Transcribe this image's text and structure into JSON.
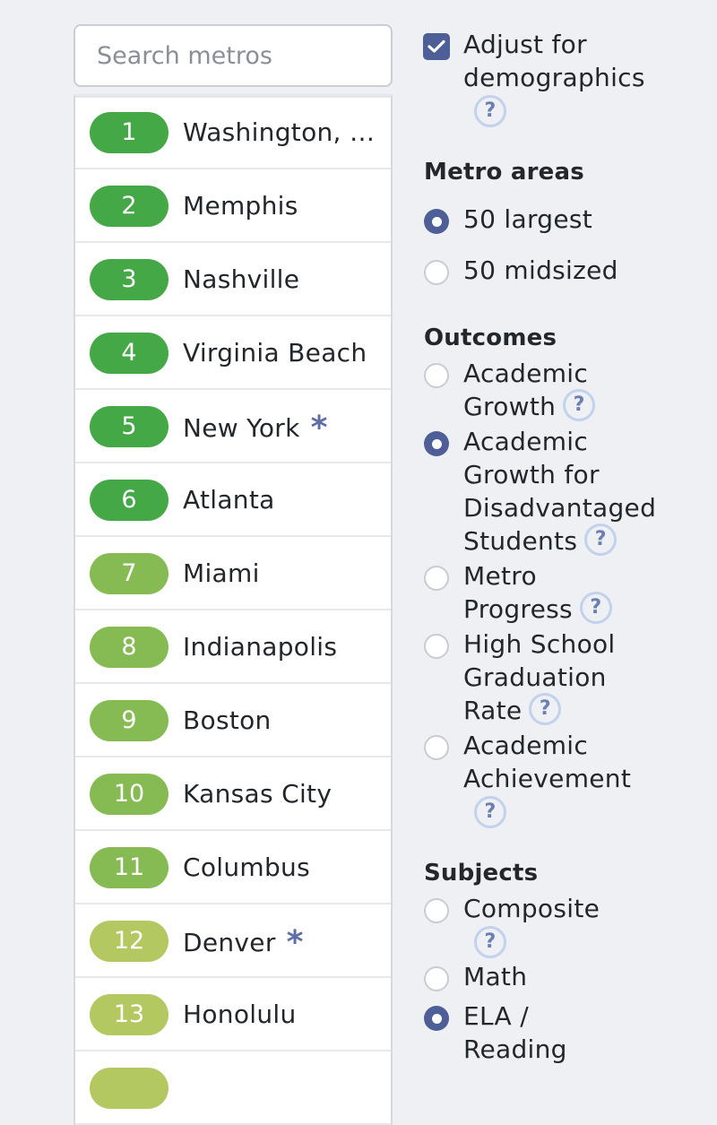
{
  "search": {
    "placeholder": "Search metros"
  },
  "rankings": [
    {
      "rank": "1",
      "name": "Washington, D...",
      "starred": false,
      "color": "#45a847"
    },
    {
      "rank": "2",
      "name": "Memphis",
      "starred": false,
      "color": "#45a847"
    },
    {
      "rank": "3",
      "name": "Nashville",
      "starred": false,
      "color": "#45a847"
    },
    {
      "rank": "4",
      "name": "Virginia Beach",
      "starred": false,
      "color": "#45a847"
    },
    {
      "rank": "5",
      "name": "New York",
      "starred": true,
      "color": "#45a847"
    },
    {
      "rank": "6",
      "name": "Atlanta",
      "starred": false,
      "color": "#45a847"
    },
    {
      "rank": "7",
      "name": "Miami",
      "starred": false,
      "color": "#85bb52"
    },
    {
      "rank": "8",
      "name": "Indianapolis",
      "starred": false,
      "color": "#85bb52"
    },
    {
      "rank": "9",
      "name": "Boston",
      "starred": false,
      "color": "#85bb52"
    },
    {
      "rank": "10",
      "name": "Kansas City",
      "starred": false,
      "color": "#85bb52"
    },
    {
      "rank": "11",
      "name": "Columbus",
      "starred": false,
      "color": "#85bb52"
    },
    {
      "rank": "12",
      "name": "Denver",
      "starred": true,
      "color": "#b4c862"
    },
    {
      "rank": "13",
      "name": "Honolulu",
      "starred": false,
      "color": "#b4c862"
    },
    {
      "rank": "",
      "name": "",
      "starred": false,
      "color": "#b4c862"
    }
  ],
  "star_glyph": "*",
  "help_glyph": "?",
  "adjust": {
    "label_line1": "Adjust for",
    "label_line2": "demographics",
    "checked": true
  },
  "metro_areas": {
    "heading": "Metro areas",
    "options": [
      {
        "label": "50 largest",
        "selected": true
      },
      {
        "label": "50 midsized",
        "selected": false
      }
    ]
  },
  "outcomes": {
    "heading": "Outcomes",
    "options": [
      {
        "lines": [
          "Academic",
          "Growth"
        ],
        "selected": false
      },
      {
        "lines": [
          "Academic",
          "Growth for",
          "Disadvantaged",
          "Students"
        ],
        "selected": true
      },
      {
        "lines": [
          "Metro",
          "Progress"
        ],
        "selected": false
      },
      {
        "lines": [
          "High School",
          "Graduation",
          "Rate"
        ],
        "selected": false
      },
      {
        "lines": [
          "Academic",
          "Achievement"
        ],
        "selected": false
      }
    ]
  },
  "subjects": {
    "heading": "Subjects",
    "options": [
      {
        "lines": [
          "Composite"
        ],
        "selected": false
      },
      {
        "lines": [
          "Math"
        ],
        "selected": false
      },
      {
        "lines": [
          "ELA /",
          "Reading"
        ],
        "selected": true
      }
    ]
  },
  "colors": {
    "accent": "#4d5f96",
    "help_border": "#c3d2ec",
    "rank_top": "#45a847",
    "rank_mid": "#85bb52",
    "rank_low": "#b4c862"
  }
}
